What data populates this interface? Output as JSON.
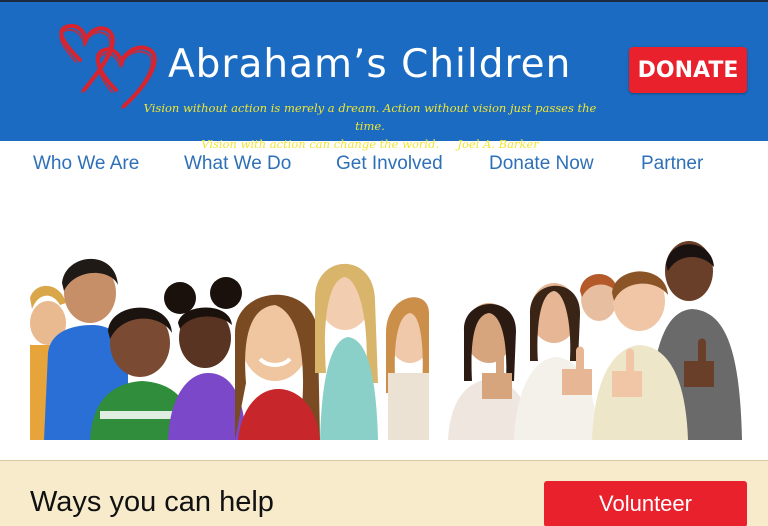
{
  "header": {
    "title": "Abraham’s Children",
    "logo_icon": "hearts-logo-icon",
    "tagline_line1": "Vision without action is merely a dream. Action without vision just passes the time.",
    "tagline_line2": "Vision with action can change the world.     Joel A. Barker",
    "donate_label": "DONATE",
    "colors": {
      "background": "#1a6bc1",
      "title": "#ffffff",
      "tagline": "#f2e532",
      "donate": "#e8212c",
      "hearts": "#d8242e"
    }
  },
  "nav": {
    "items": [
      {
        "label": "Who We Are"
      },
      {
        "label": "What We Do"
      },
      {
        "label": "Get Involved"
      },
      {
        "label": "Donate Now"
      },
      {
        "label": "Partner"
      }
    ],
    "color": "#2e70b8"
  },
  "hero": {
    "images": [
      {
        "name": "group-of-smiling-children-photo"
      },
      {
        "name": "children-thumbs-up-photo"
      }
    ]
  },
  "help": {
    "heading": "Ways you can help",
    "volunteer_label": "Volunteer",
    "background": "#f7ebcc"
  }
}
